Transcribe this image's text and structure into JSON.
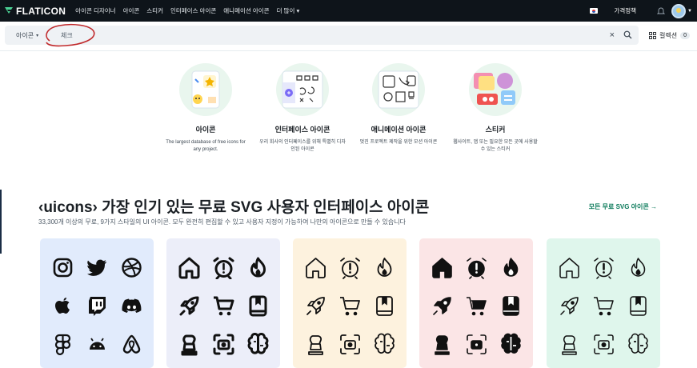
{
  "brand": {
    "name": "FLATICON"
  },
  "nav": [
    {
      "label": "아이콘 디자이너"
    },
    {
      "label": "아이콘"
    },
    {
      "label": "스티커"
    },
    {
      "label": "인터페이스 아이콘"
    },
    {
      "label": "애니메이션 아이콘"
    },
    {
      "label": "더 많이"
    }
  ],
  "header_right": {
    "pricing": "가격정책"
  },
  "search": {
    "type_label": "아이콘",
    "value": "체크",
    "placeholder": ""
  },
  "collections": {
    "label": "컬렉션",
    "count": "0"
  },
  "categories": [
    {
      "title": "아이콘",
      "desc": "The largest database of free icons for any project.",
      "bg": "#e9f6ee"
    },
    {
      "title": "인터페이스 아이콘",
      "desc": "우리 회사의 인터페이스를 위해 특별히 디자인된 아이콘",
      "bg": "#e9f6ee"
    },
    {
      "title": "애니메이션 아이콘",
      "desc": "멋진 프로젝트 제작을 위한 모션 아이콘",
      "bg": "#e9f6ee"
    },
    {
      "title": "스티커",
      "desc": "웹사이트, 앱 또는 필요한 모든 곳에 사용할 수 있는 스티커",
      "bg": "#e9f6ee"
    }
  ],
  "section": {
    "brand": "‹uicons›",
    "title": "가장 인기 있는 무료 SVG 사용자 인터페이스 아이콘",
    "subtitle": "33,300개 이상의 무료, 9가지 스타일의 UI 아이콘. 모두 완전히 편집할 수 있고 사용자 지정이 가능하여 나만의 아이콘으로 만들 수 있습니다",
    "more_link": "모든 무료 SVG 아이콘 →"
  },
  "cards": [
    {
      "style": "brands",
      "bg": "#e1ebfc",
      "icons": [
        "instagram-icon",
        "twitter-icon",
        "dribbble-icon",
        "apple-icon",
        "twitch-icon",
        "discord-icon",
        "figma-icon",
        "android-icon",
        "airbnb-icon"
      ]
    },
    {
      "style": "bold-rounded",
      "bg": "#eceef9",
      "icons": [
        "home-icon",
        "alarm-icon",
        "flame-icon",
        "rocket-icon",
        "cart-icon",
        "book-icon",
        "chess-icon",
        "camera-icon",
        "brain-icon"
      ]
    },
    {
      "style": "regular-rounded",
      "bg": "#fdf2de",
      "icons": [
        "home-icon",
        "alarm-icon",
        "flame-icon",
        "rocket-icon",
        "cart-icon",
        "book-icon",
        "chess-icon",
        "camera-icon",
        "brain-icon"
      ]
    },
    {
      "style": "solid",
      "bg": "#fbe5e6",
      "icons": [
        "home-icon",
        "alarm-icon",
        "flame-icon",
        "rocket-icon",
        "cart-icon",
        "book-icon",
        "chess-icon",
        "camera-icon",
        "brain-icon"
      ]
    },
    {
      "style": "straight",
      "bg": "#dff6ec",
      "icons": [
        "home-icon",
        "alarm-icon",
        "flame-icon",
        "rocket-icon",
        "cart-icon",
        "book-icon",
        "chess-icon",
        "camera-icon",
        "brain-icon"
      ]
    }
  ],
  "colors": {
    "topbar": "#0e141a",
    "accent": "#0a7a5a",
    "annotation": "#c0292b"
  }
}
